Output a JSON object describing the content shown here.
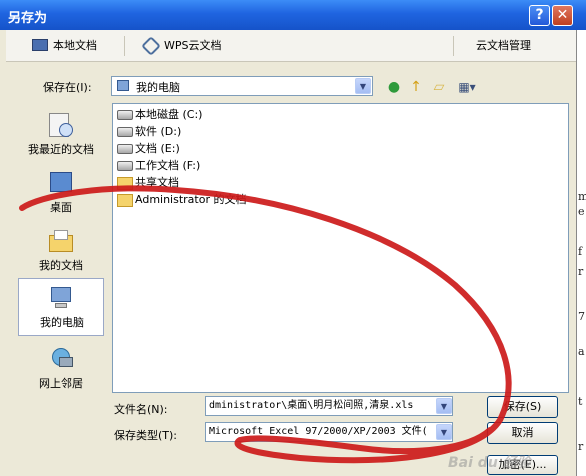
{
  "window": {
    "title": "另存为",
    "help_label": "?",
    "close_label": "✕"
  },
  "tabs": {
    "local": "本地文档",
    "wps_cloud": "WPS云文档",
    "manage": "云文档管理"
  },
  "save_in": {
    "label": "保存在(I):",
    "value": "我的电脑"
  },
  "toolbar": {
    "back": "back-icon",
    "up": "up-folder-icon",
    "new_folder": "new-folder-icon",
    "views": "views-icon"
  },
  "places": [
    {
      "label": "我最近的文档",
      "icon": "recent-documents-icon"
    },
    {
      "label": "桌面",
      "icon": "desktop-icon"
    },
    {
      "label": "我的文档",
      "icon": "my-documents-icon"
    },
    {
      "label": "我的电脑",
      "icon": "my-computer-icon"
    },
    {
      "label": "网上邻居",
      "icon": "network-places-icon"
    }
  ],
  "files": [
    {
      "name": "本地磁盘 (C:)",
      "icon": "drive-icon"
    },
    {
      "name": "软件 (D:)",
      "icon": "drive-icon"
    },
    {
      "name": "文档 (E:)",
      "icon": "drive-icon"
    },
    {
      "name": "工作文档 (F:)",
      "icon": "drive-icon"
    },
    {
      "name": "共享文档",
      "icon": "folder-icon"
    },
    {
      "name": "Administrator 的文档",
      "icon": "folder-icon"
    }
  ],
  "filename": {
    "label": "文件名(N):",
    "value": "dministrator\\桌面\\明月松间照,清泉.xls"
  },
  "filetype": {
    "label": "保存类型(T):",
    "value": "Microsoft Excel 97/2000/XP/2003 文件("
  },
  "buttons": {
    "save": "保存(S)",
    "cancel": "取消",
    "encrypt": "加密(E)..."
  },
  "watermark": "Bai du 经验",
  "background_chars": [
    "m",
    "e",
    "f",
    "r",
    "7",
    "a",
    "t",
    "r"
  ]
}
